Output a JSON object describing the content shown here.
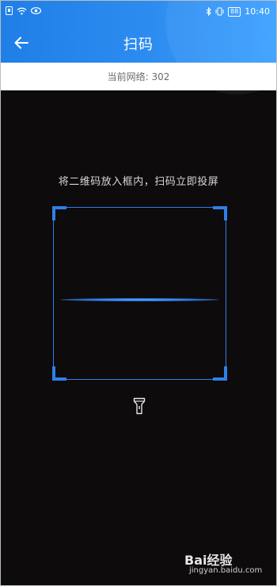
{
  "status_bar": {
    "time": "10:40",
    "battery": "88"
  },
  "header": {
    "title": "扫码"
  },
  "network": {
    "label": "当前网络: 302"
  },
  "scan": {
    "hint": "将二维码放入框内，扫码立即投屏"
  },
  "watermark": {
    "brand": "Bai经验",
    "url": "jingyan.baidu.com"
  },
  "colors": {
    "primary": "#2d8cf0",
    "scan_frame": "#2f7fe8",
    "background": "#0d0b0c"
  }
}
